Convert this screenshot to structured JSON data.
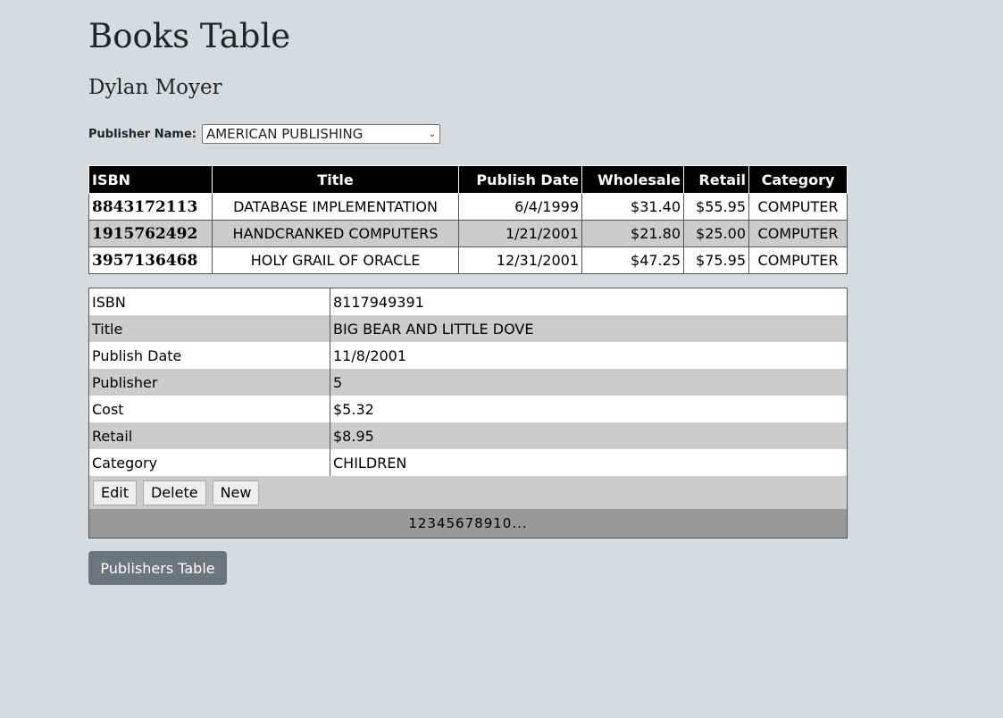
{
  "page": {
    "title": "Books Table",
    "subtitle": "Dylan Moyer"
  },
  "publisher_filter": {
    "label": "Publisher Name:",
    "selected": "AMERICAN PUBLISHING"
  },
  "books_table": {
    "headers": [
      "ISBN",
      "Title",
      "Publish Date",
      "Wholesale",
      "Retail",
      "Category"
    ],
    "rows": [
      [
        "8843172113",
        "DATABASE IMPLEMENTATION",
        "6/4/1999",
        "$31.40",
        "$55.95",
        "COMPUTER"
      ],
      [
        "1915762492",
        "HANDCRANKED COMPUTERS",
        "1/21/2001",
        "$21.80",
        "$25.00",
        "COMPUTER"
      ],
      [
        "3957136468",
        "HOLY GRAIL OF ORACLE",
        "12/31/2001",
        "$47.25",
        "$75.95",
        "COMPUTER"
      ]
    ]
  },
  "detail": {
    "fields": [
      {
        "key": "ISBN",
        "value": "8117949391"
      },
      {
        "key": "Title",
        "value": "BIG BEAR AND LITTLE DOVE"
      },
      {
        "key": "Publish Date",
        "value": "11/8/2001"
      },
      {
        "key": "Publisher",
        "value": "5"
      },
      {
        "key": "Cost",
        "value": "$5.32"
      },
      {
        "key": "Retail",
        "value": "$8.95"
      },
      {
        "key": "Category",
        "value": "CHILDREN"
      }
    ],
    "buttons": {
      "edit": "Edit",
      "delete": "Delete",
      "new": "New"
    },
    "pager": "12345678910..."
  },
  "nav": {
    "publishers_button": "Publishers Table"
  }
}
